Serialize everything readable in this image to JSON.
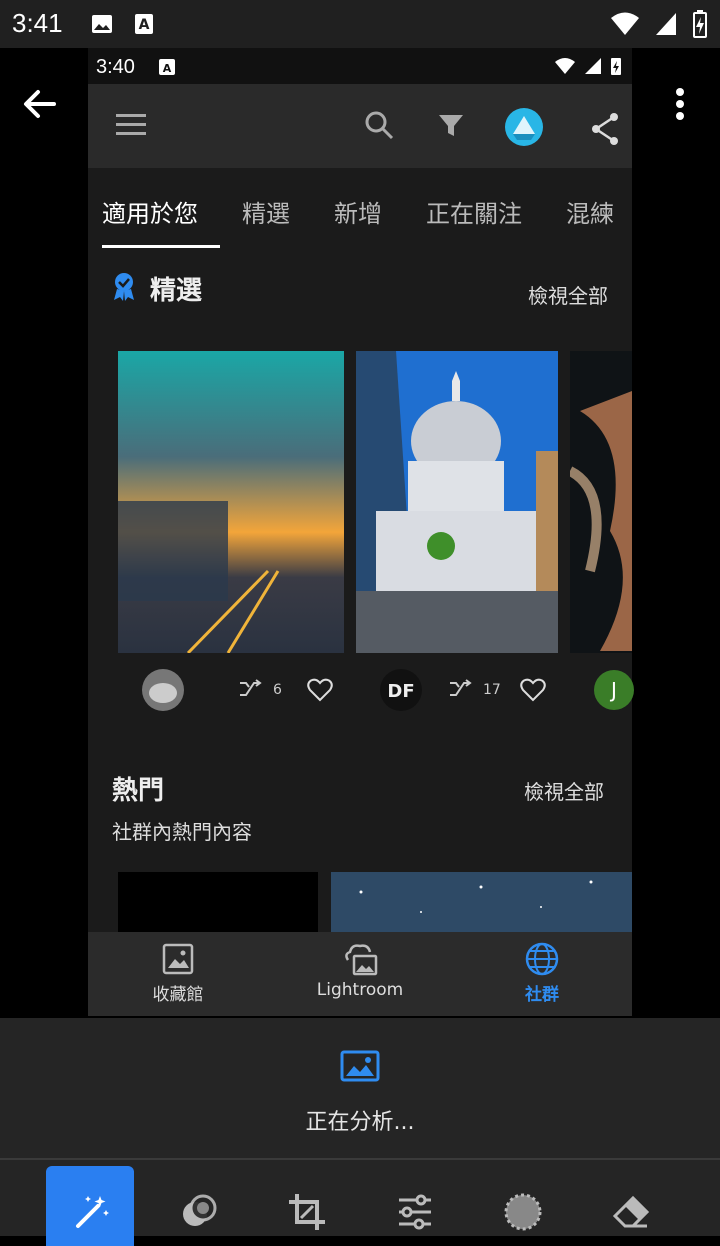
{
  "outer_status": {
    "time": "3:41"
  },
  "inner_status": {
    "time": "3:40"
  },
  "tabs": [
    "適用於您",
    "精選",
    "新增",
    "正在關注",
    "混練"
  ],
  "featured": {
    "title": "精選",
    "view_all": "檢視全部"
  },
  "cards": [
    {
      "shares": "6"
    },
    {
      "shares": "17"
    },
    {
      "avatar_letter": "J"
    }
  ],
  "popular": {
    "title": "熱門",
    "subtitle": "社群內熱門內容",
    "view_all": "檢視全部"
  },
  "bottom_nav": [
    {
      "label": "收藏館"
    },
    {
      "label": "Lightroom"
    },
    {
      "label": "社群"
    }
  ],
  "editor": {
    "status": "正在分析..."
  },
  "colors": {
    "accent": "#2f8cf0",
    "tool_active": "#2a7ff1"
  }
}
